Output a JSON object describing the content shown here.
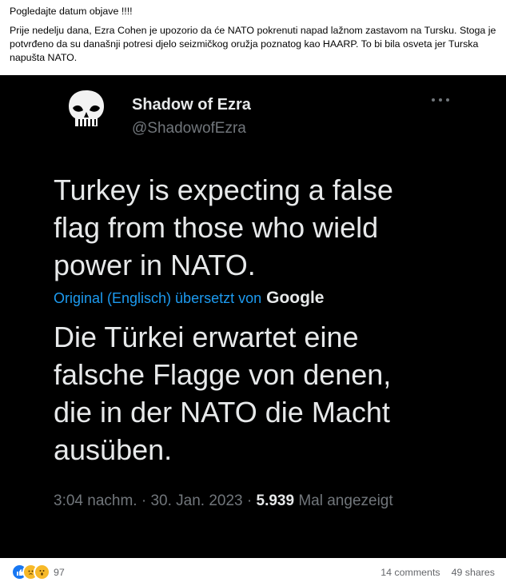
{
  "post": {
    "paragraphs": [
      "Pogledajte datum objave !!!!",
      "Prije nedelju dana, Ezra Cohen je upozorio da će NATO pokrenuti napad lažnom zastavom na Tursku. Stoga je potvrđeno da su današnji potresi djelo seizmičkog oružja poznatog kao HAARP. To bi bila osveta jer Turska napušta NATO."
    ]
  },
  "tweet": {
    "author_name": "Shadow of Ezra",
    "author_handle": "@ShadowofEzra",
    "text_original": "Turkey is expecting a false flag from those who wield power in NATO.",
    "translation_label": "Original (Englisch) übersetzt von",
    "translation_provider": "Google",
    "text_translated": "Die Türkei erwartet eine falsche Flagge von denen, die in der NATO die Macht ausüben.",
    "time": "3:04 nachm.",
    "separator": "·",
    "date": "30. Jan. 2023",
    "view_count": "5.939",
    "views_label": "Mal angezeigt",
    "avatar_icon": "punisher-skull-icon",
    "more_icon": "more-options-icon"
  },
  "footer": {
    "reaction_count": "97",
    "comments": "14 comments",
    "shares": "49 shares",
    "reaction_icons": [
      "like-icon",
      "sad-icon",
      "wow-icon"
    ]
  },
  "colors": {
    "tweet_background": "#000000",
    "tweet_text": "#e7e9ea",
    "muted_text": "#71767b",
    "link_blue": "#1d9bf0",
    "like_blue": "#1877f2",
    "reaction_yellow": "#f7b928"
  }
}
